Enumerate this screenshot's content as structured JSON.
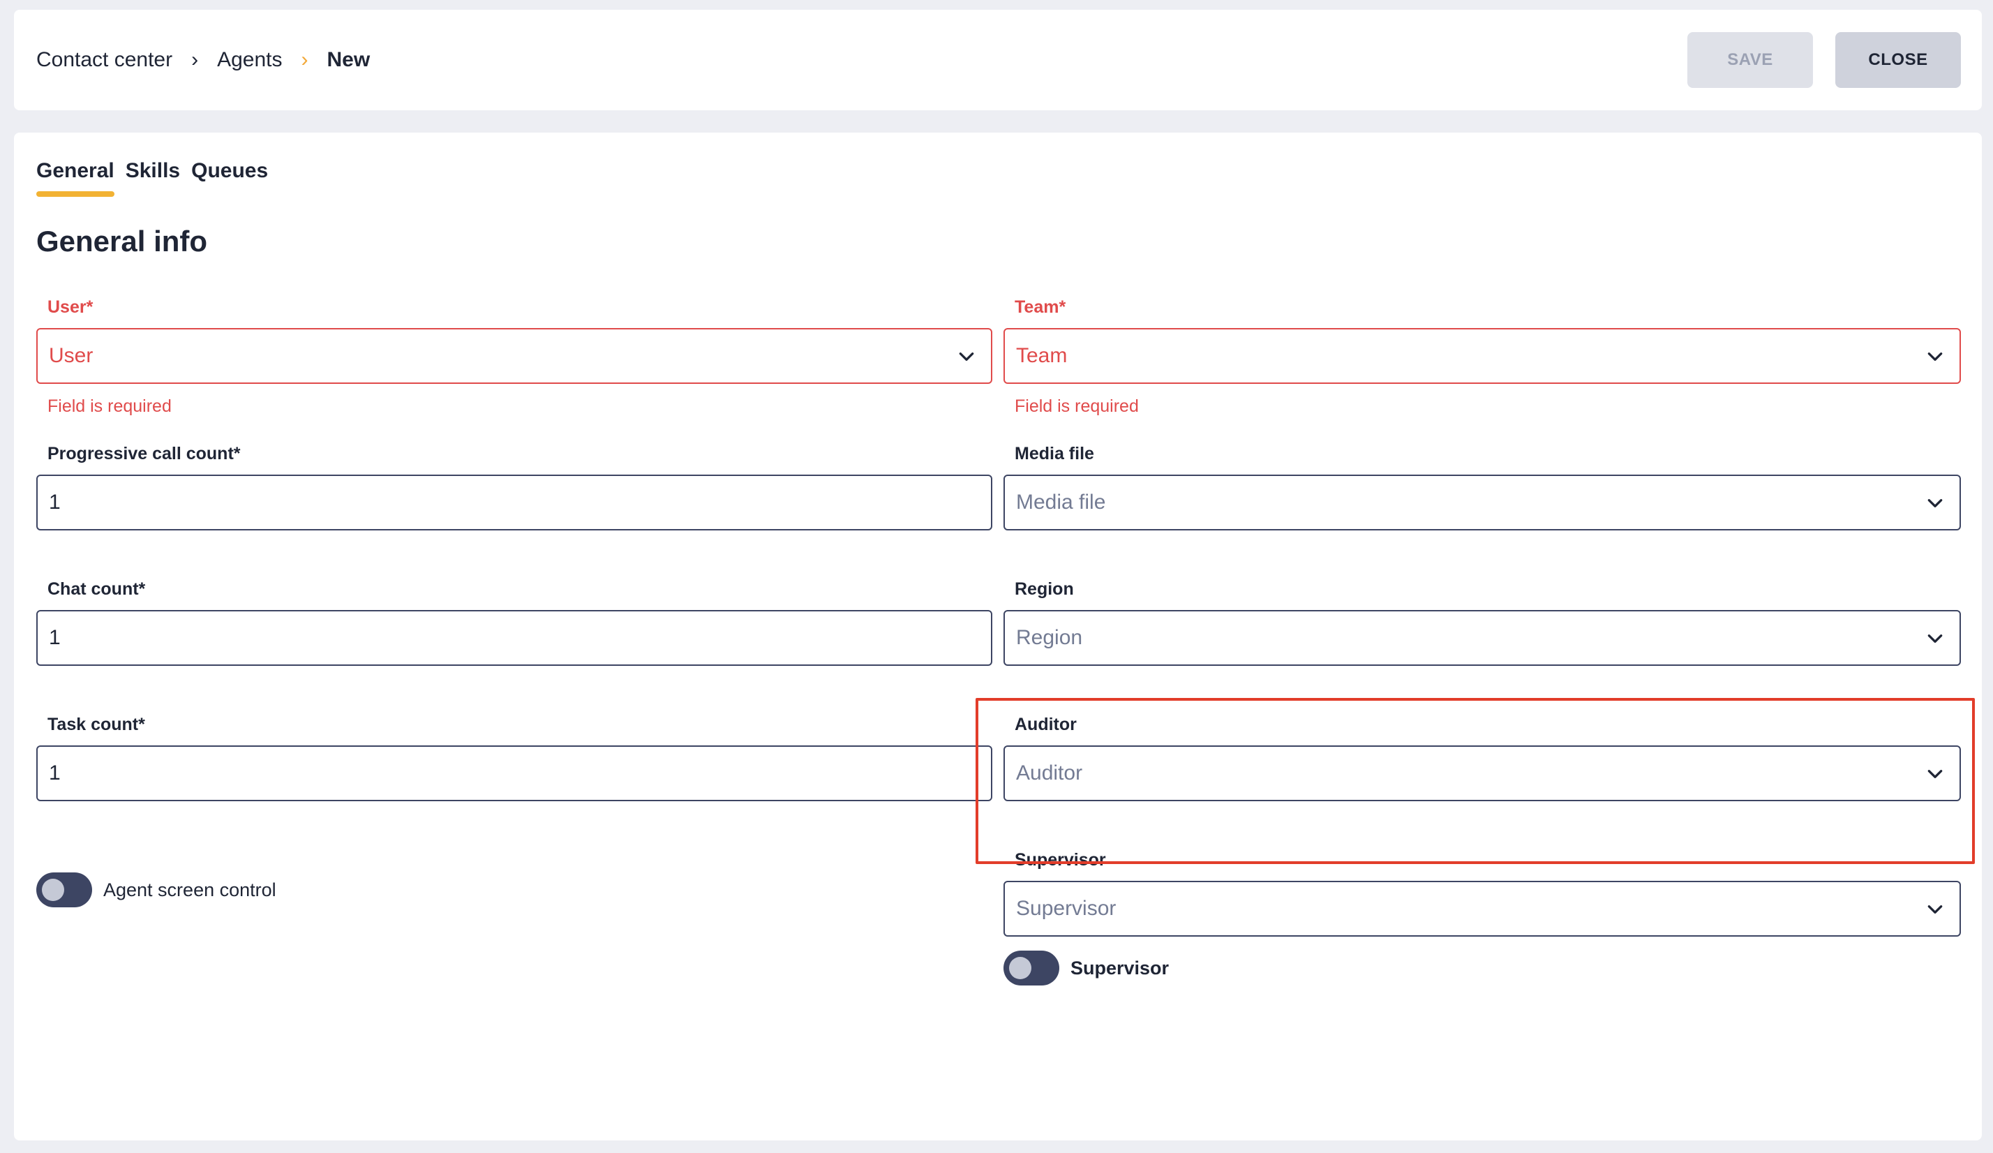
{
  "breadcrumb": {
    "items": [
      "Contact center",
      "Agents",
      "New"
    ],
    "separator": "›"
  },
  "actions": {
    "save_label": "SAVE",
    "close_label": "CLOSE"
  },
  "tabs": [
    {
      "label": "General",
      "active": true
    },
    {
      "label": "Skills",
      "active": false
    },
    {
      "label": "Queues",
      "active": false
    }
  ],
  "section_title": "General info",
  "form": {
    "user": {
      "label": "User*",
      "placeholder": "User",
      "error": "Field is required"
    },
    "team": {
      "label": "Team*",
      "placeholder": "Team",
      "error": "Field is required"
    },
    "progressive_call_count": {
      "label": "Progressive call count*",
      "value": "1"
    },
    "media_file": {
      "label": "Media file",
      "placeholder": "Media file"
    },
    "chat_count": {
      "label": "Chat count*",
      "value": "1"
    },
    "region": {
      "label": "Region",
      "placeholder": "Region"
    },
    "task_count": {
      "label": "Task count*",
      "value": "1"
    },
    "auditor": {
      "label": "Auditor",
      "placeholder": "Auditor"
    },
    "agent_screen_control": {
      "label": "Agent screen control",
      "on": false
    },
    "supervisor_select": {
      "label": "Supervisor",
      "placeholder": "Supervisor"
    },
    "supervisor_toggle": {
      "label": "Supervisor",
      "on": false
    }
  },
  "colors": {
    "accent": "#f2b233",
    "error": "#e04b4b",
    "highlight": "#e23d2a",
    "border": "#3d4563"
  },
  "icons": {
    "dropdown": "chevron-down-icon",
    "breadcrumb_separator": "chevron-right-icon"
  }
}
